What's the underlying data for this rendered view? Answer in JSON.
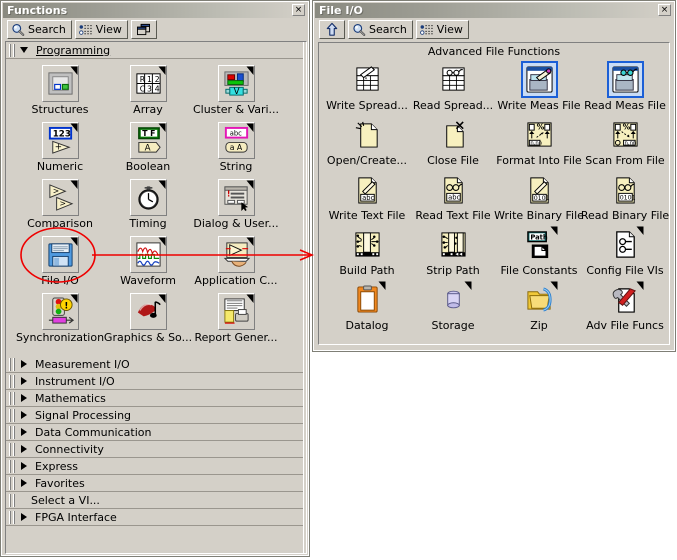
{
  "functions_window": {
    "title": "Functions",
    "close_label": "×",
    "toolbar": {
      "search_label": "Search",
      "view_label": "View",
      "pin_label": ""
    },
    "programming": {
      "label": "Programming",
      "items": [
        {
          "caption": "Structures",
          "icon": "structures-icon"
        },
        {
          "caption": "Array",
          "icon": "array-icon"
        },
        {
          "caption": "Cluster & Vari...",
          "icon": "cluster-icon"
        },
        {
          "caption": "Numeric",
          "icon": "numeric-icon"
        },
        {
          "caption": "Boolean",
          "icon": "boolean-icon"
        },
        {
          "caption": "String",
          "icon": "string-icon"
        },
        {
          "caption": "Comparison",
          "icon": "comparison-icon"
        },
        {
          "caption": "Timing",
          "icon": "timing-icon"
        },
        {
          "caption": "Dialog & User...",
          "icon": "dialog-icon"
        },
        {
          "caption": "File I/O",
          "icon": "file-io-icon"
        },
        {
          "caption": "Waveform",
          "icon": "waveform-icon"
        },
        {
          "caption": "Application C...",
          "icon": "application-control-icon"
        },
        {
          "caption": "Synchronization",
          "icon": "synchronization-icon"
        },
        {
          "caption": "Graphics & So...",
          "icon": "graphics-sound-icon"
        },
        {
          "caption": "Report Gener...",
          "icon": "report-generation-icon"
        }
      ]
    },
    "categories": [
      {
        "label": "Measurement I/O",
        "expandable": true
      },
      {
        "label": "Instrument I/O",
        "expandable": true
      },
      {
        "label": "Mathematics",
        "expandable": true
      },
      {
        "label": "Signal Processing",
        "expandable": true
      },
      {
        "label": "Data Communication",
        "expandable": true
      },
      {
        "label": "Connectivity",
        "expandable": true
      },
      {
        "label": "Express",
        "expandable": true
      },
      {
        "label": "Favorites",
        "expandable": true
      },
      {
        "label": "Select a VI...",
        "expandable": false
      },
      {
        "label": "FPGA Interface",
        "expandable": true
      }
    ]
  },
  "fileio_window": {
    "title": "File I/O",
    "close_label": "×",
    "toolbar": {
      "up_label": "",
      "search_label": "Search",
      "view_label": "View"
    },
    "subpalette_title": "Advanced File Functions",
    "items": [
      {
        "caption": "Write Spread...",
        "icon": "write-spreadsheet-icon",
        "selected": false,
        "subpalette": false
      },
      {
        "caption": "Read Spread...",
        "icon": "read-spreadsheet-icon",
        "selected": false,
        "subpalette": false
      },
      {
        "caption": "Write Meas File",
        "icon": "write-measurement-file-icon",
        "selected": true,
        "subpalette": false
      },
      {
        "caption": "Read Meas File",
        "icon": "read-measurement-file-icon",
        "selected": true,
        "subpalette": false
      },
      {
        "caption": "Open/Create...",
        "icon": "open-create-replace-file-icon",
        "selected": false,
        "subpalette": false
      },
      {
        "caption": "Close File",
        "icon": "close-file-icon",
        "selected": false,
        "subpalette": false
      },
      {
        "caption": "Format Into File",
        "icon": "format-into-file-icon",
        "selected": false,
        "subpalette": false
      },
      {
        "caption": "Scan From File",
        "icon": "scan-from-file-icon",
        "selected": false,
        "subpalette": false
      },
      {
        "caption": "Write Text File",
        "icon": "write-text-file-icon",
        "selected": false,
        "subpalette": false
      },
      {
        "caption": "Read Text File",
        "icon": "read-text-file-icon",
        "selected": false,
        "subpalette": false
      },
      {
        "caption": "Write Binary File",
        "icon": "write-binary-file-icon",
        "selected": false,
        "subpalette": false
      },
      {
        "caption": "Read Binary File",
        "icon": "read-binary-file-icon",
        "selected": false,
        "subpalette": false
      },
      {
        "caption": "Build Path",
        "icon": "build-path-icon",
        "selected": false,
        "subpalette": false
      },
      {
        "caption": "Strip Path",
        "icon": "strip-path-icon",
        "selected": false,
        "subpalette": false
      },
      {
        "caption": "File Constants",
        "icon": "file-constants-icon",
        "selected": false,
        "subpalette": true
      },
      {
        "caption": "Config File VIs",
        "icon": "config-file-vis-icon",
        "selected": false,
        "subpalette": true
      },
      {
        "caption": "Datalog",
        "icon": "datalog-icon",
        "selected": false,
        "subpalette": true
      },
      {
        "caption": "Storage",
        "icon": "storage-icon",
        "selected": false,
        "subpalette": true
      },
      {
        "caption": "Zip",
        "icon": "zip-icon",
        "selected": false,
        "subpalette": true
      },
      {
        "caption": "Adv File Funcs",
        "icon": "advanced-file-functions-icon",
        "selected": false,
        "subpalette": true
      }
    ]
  },
  "annotation": {
    "color": "#ee0000",
    "shape": "ellipse-with-arrow",
    "target": "File I/O"
  },
  "colors": {
    "face": "#d4d0c8",
    "selection_border": "#1b5fd6",
    "annotation_red": "#ee0000",
    "title_text": "#ffffff"
  }
}
